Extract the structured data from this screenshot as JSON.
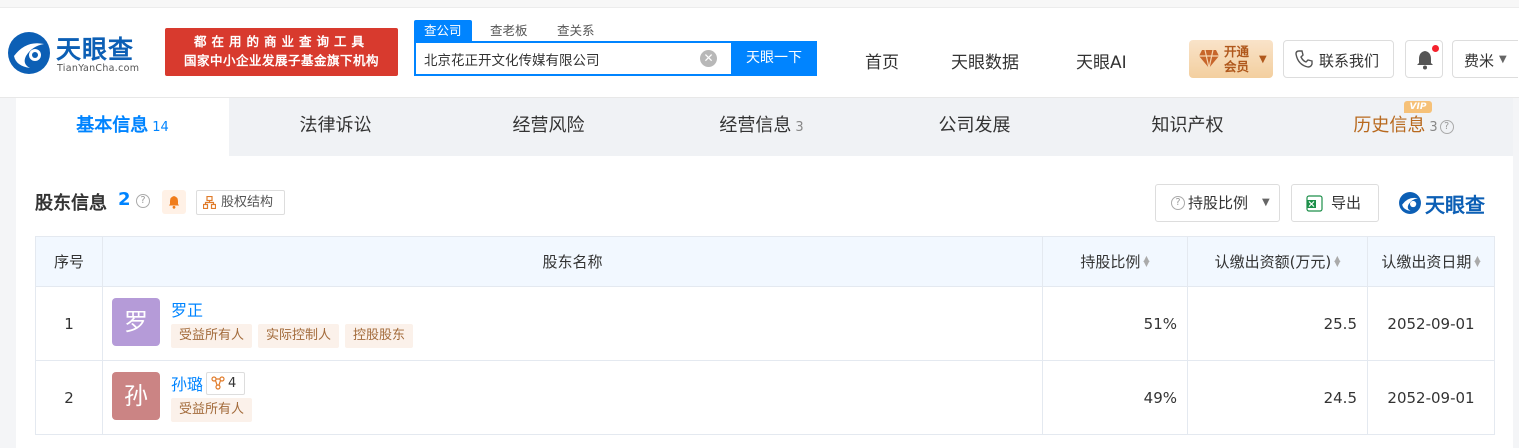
{
  "header": {
    "logo_text": "天眼查",
    "logo_sub": "TianYanCha.com",
    "banner_line1": "都在用的商业查询工具",
    "banner_line2": "国家中小企业发展子基金旗下机构",
    "search_tabs": [
      "查公司",
      "查老板",
      "查关系"
    ],
    "search_value": "北京花正开文化传媒有限公司",
    "search_button": "天眼一下",
    "nav": [
      "首页",
      "天眼数据",
      "天眼AI"
    ],
    "vip_line1": "开通",
    "vip_line2": "会员",
    "contact": "联系我们",
    "user": "费米"
  },
  "tabs": [
    {
      "label": "基本信息",
      "count": "14",
      "active": true
    },
    {
      "label": "法律诉讼",
      "count": ""
    },
    {
      "label": "经营风险",
      "count": ""
    },
    {
      "label": "经营信息",
      "count": "3"
    },
    {
      "label": "公司发展",
      "count": ""
    },
    {
      "label": "知识产权",
      "count": ""
    },
    {
      "label": "历史信息",
      "count": "3"
    }
  ],
  "vip_tag": "VIP",
  "section": {
    "title": "股东信息",
    "count": "2",
    "equity_button": "股权结构",
    "ratio_button": "持股比例",
    "export_button": "导出",
    "watermark": "天眼查"
  },
  "table": {
    "headers": [
      "序号",
      "股东名称",
      "持股比例",
      "认缴出资额(万元)",
      "认缴出资日期"
    ],
    "rows": [
      {
        "index": "1",
        "avatar": "罗",
        "avatar_color": "#b59bd8",
        "name": "罗正",
        "related": "",
        "tags": [
          "受益所有人",
          "实际控制人",
          "控股股东"
        ],
        "ratio": "51%",
        "amount": "25.5",
        "date": "2052-09-01"
      },
      {
        "index": "2",
        "avatar": "孙",
        "avatar_color": "#cb8484",
        "name": "孙璐",
        "related": "4",
        "tags": [
          "受益所有人"
        ],
        "ratio": "49%",
        "amount": "24.5",
        "date": "2052-09-01"
      }
    ]
  },
  "colors": {
    "accent": "#0084ff",
    "brand": "#0c5fb5",
    "banner": "#d83a2e",
    "history_tab": "#b8691e"
  }
}
